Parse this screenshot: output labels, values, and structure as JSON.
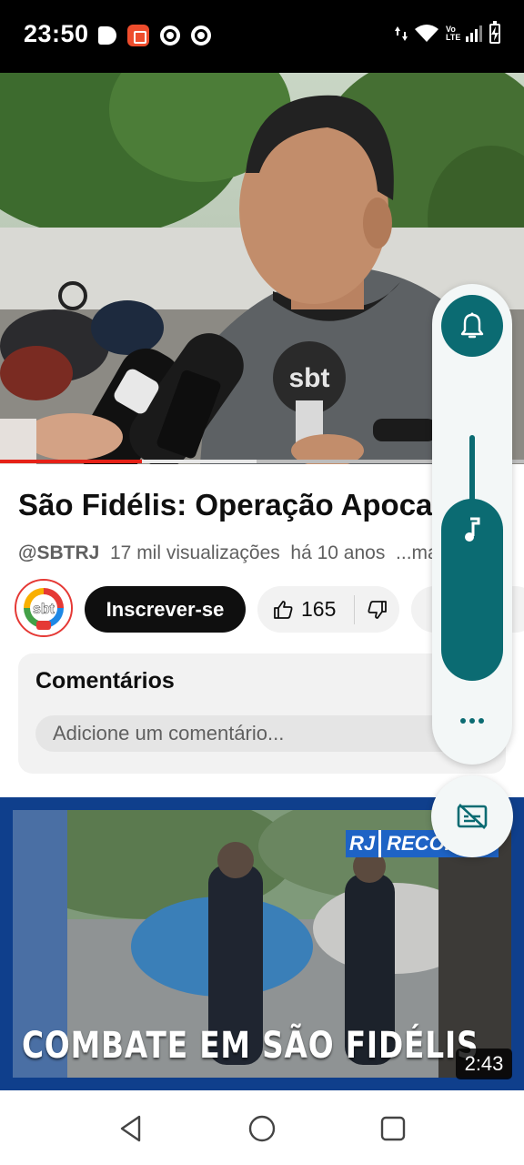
{
  "status_bar": {
    "time": "23:50",
    "notification_icons": [
      "b-app-icon",
      "shopee-icon",
      "chrome-icon",
      "chrome-icon"
    ],
    "system_icons": [
      "data-arrows-icon",
      "wifi-icon",
      "volte-icon",
      "signal-icon",
      "battery-charging-icon"
    ],
    "volte_label": "Vo LTE"
  },
  "video": {
    "progress_fraction": 0.27,
    "buffer_fraction": 0.49,
    "progress_color": "#e62117",
    "watermark": "sbt"
  },
  "details": {
    "title": "São Fidélis: Operação Apocalipse",
    "channel_handle": "@SBTRJ",
    "views": "17 mil visualizações",
    "age": "há 10 anos",
    "more": "...mais",
    "channel_logo_text": "sbt",
    "subscribe_label": "Inscrever-se",
    "likes": "165"
  },
  "comments": {
    "title": "Comentários",
    "placeholder": "Adicione um comentário..."
  },
  "next_video": {
    "caption": "COMBATE EM SÃO FIDÉLIS",
    "duration": "2:43",
    "channel_tag_a": "RJ",
    "channel_tag_b": "RECORD",
    "border_color": "#0f3f8c"
  },
  "volume_panel": {
    "accent_color": "#0b6b72",
    "media_level": 0.75,
    "icons": [
      "bell-icon",
      "music-note-icon",
      "more-dots-icon",
      "captions-off-icon"
    ]
  },
  "nav_bar": {
    "icons": [
      "back-icon",
      "home-icon",
      "recents-icon"
    ]
  }
}
